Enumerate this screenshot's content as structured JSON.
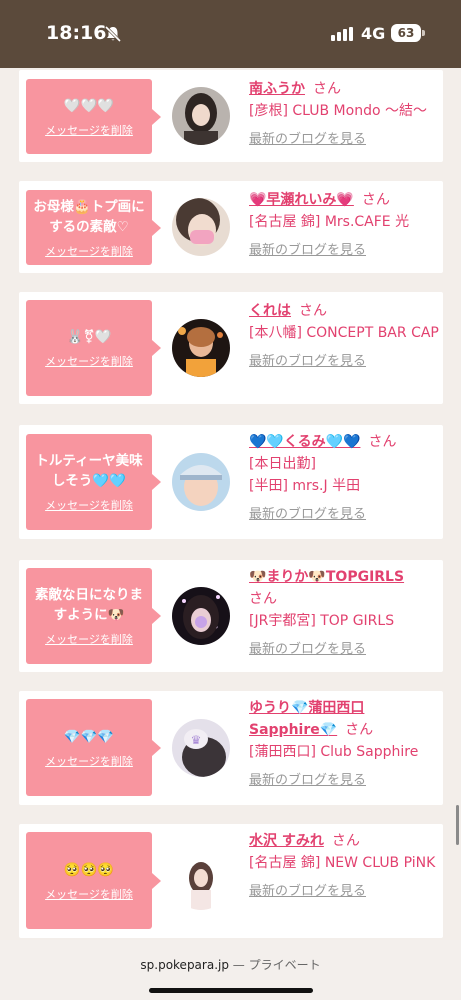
{
  "status_bar": {
    "time": "18:16",
    "network": "4G",
    "battery": "63"
  },
  "browser": {
    "domain": "sp.pokepara.jp",
    "suffix": " — プライベート"
  },
  "delete_label": "メッセージを削除",
  "blog_label": "最新のブログを見る",
  "san": "さん",
  "colors": {
    "accent": "#e2416f",
    "bubble": "#f8959f",
    "status_bar": "#5b4a3b"
  },
  "cards": [
    {
      "message": "🤍🤍🤍",
      "name": "南ふうか",
      "lines": [
        "[彦根] CLUB Mondo 〜結〜"
      ],
      "avatar": "avatar-dark-hair"
    },
    {
      "message": "お母様🎂トプ画にするの素敵♡",
      "name": "💗早瀬れいみ💗",
      "lines": [
        "[名古屋 錦] Mrs.CAFE 光"
      ],
      "avatar": "avatar-pink-mask"
    },
    {
      "message": "🐰⚧🤍",
      "name": "くれは",
      "lines": [
        "[本八幡] CONCEPT BAR CAP"
      ],
      "avatar": "avatar-bar"
    },
    {
      "message": "トルティーヤ美味しそう🩵🩵",
      "name": "💙🩵くるみ🩵💙",
      "lines": [
        "[本日出勤]",
        "[半田] mrs.J 半田"
      ],
      "avatar": "avatar-blue-cap"
    },
    {
      "message": "素敵な日になりますように🐶",
      "name": "🐶まりか🐶TOPGIRLS",
      "lines": [
        "[JR宇都宮] TOP GIRLS"
      ],
      "avatar": "avatar-night"
    },
    {
      "message": "💎💎💎",
      "name": "ゆうり💎蒲田西口 Sapphire💎",
      "lines": [
        "[蒲田西口] Club Sapphire"
      ],
      "avatar": "avatar-hidden-face"
    },
    {
      "message": "🥺🥺🥺",
      "name": "水沢 すみれ",
      "lines": [
        "[名古屋 錦] NEW CLUB PiNK"
      ],
      "avatar": "avatar-white-bg"
    }
  ]
}
